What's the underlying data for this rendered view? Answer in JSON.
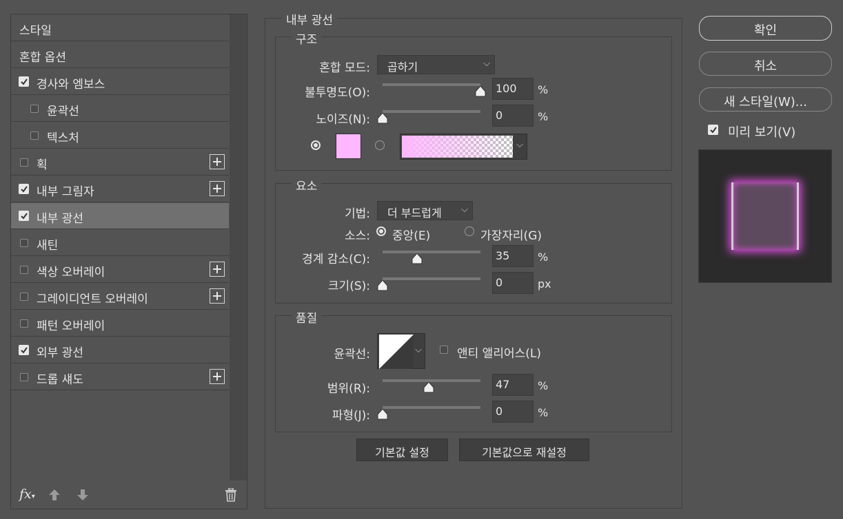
{
  "styles_list": {
    "items": [
      {
        "label": "스타일",
        "checkbox": false,
        "checked": false,
        "plus": false,
        "selected": false,
        "indent": false
      },
      {
        "label": "혼합 옵션",
        "checkbox": false,
        "checked": false,
        "plus": false,
        "selected": false,
        "indent": false
      },
      {
        "label": "경사와 엠보스",
        "checkbox": true,
        "checked": true,
        "plus": false,
        "selected": false,
        "indent": false
      },
      {
        "label": "윤곽선",
        "checkbox": true,
        "checked": false,
        "plus": false,
        "selected": false,
        "indent": true
      },
      {
        "label": "텍스처",
        "checkbox": true,
        "checked": false,
        "plus": false,
        "selected": false,
        "indent": true
      },
      {
        "label": "획",
        "checkbox": true,
        "checked": false,
        "plus": true,
        "selected": false,
        "indent": false
      },
      {
        "label": "내부 그림자",
        "checkbox": true,
        "checked": true,
        "plus": true,
        "selected": false,
        "indent": false
      },
      {
        "label": "내부 광선",
        "checkbox": true,
        "checked": true,
        "plus": false,
        "selected": true,
        "indent": false
      },
      {
        "label": "새틴",
        "checkbox": true,
        "checked": false,
        "plus": false,
        "selected": false,
        "indent": false
      },
      {
        "label": "색상 오버레이",
        "checkbox": true,
        "checked": false,
        "plus": true,
        "selected": false,
        "indent": false
      },
      {
        "label": "그레이디언트 오버레이",
        "checkbox": true,
        "checked": false,
        "plus": true,
        "selected": false,
        "indent": false
      },
      {
        "label": "패턴 오버레이",
        "checkbox": true,
        "checked": false,
        "plus": false,
        "selected": false,
        "indent": false
      },
      {
        "label": "외부 광선",
        "checkbox": true,
        "checked": true,
        "plus": false,
        "selected": false,
        "indent": false
      },
      {
        "label": "드롭 섀도",
        "checkbox": true,
        "checked": false,
        "plus": true,
        "selected": false,
        "indent": false
      }
    ],
    "footer": {
      "fx_label": "fx",
      "fx_icon": "fx-icon",
      "up_icon": "arrow-up-icon",
      "down_icon": "arrow-down-icon",
      "trash_icon": "trash-icon"
    }
  },
  "panel": {
    "title": "내부 광선",
    "structure": {
      "title": "구조",
      "blend_mode_label": "혼합 모드:",
      "blend_mode_value": "곱하기",
      "opacity_label": "불투명도(O):",
      "opacity_value": "100",
      "opacity_pct": 100,
      "noise_label": "노이즈(N):",
      "noise_value": "0",
      "noise_pct": 0,
      "unit_percent": "%",
      "glow_color": "#ffb7ff",
      "solid_selected": true
    },
    "elements": {
      "title": "요소",
      "technique_label": "기법:",
      "technique_value": "더 부드럽게",
      "source_label": "소스:",
      "source_center": "중앙(E)",
      "source_edge": "가장자리(G)",
      "source_center_selected": true,
      "choke_label": "경계 감소(C):",
      "choke_value": "35",
      "choke_pct": 35,
      "size_label": "크기(S):",
      "size_value": "0",
      "size_pct": 0,
      "unit_percent": "%",
      "unit_px": "px"
    },
    "quality": {
      "title": "품질",
      "contour_label": "윤곽선:",
      "anti_alias_label": "앤티 앨리어스(L)",
      "anti_alias_checked": false,
      "range_label": "범위(R):",
      "range_value": "47",
      "range_pct": 47,
      "jitter_label": "파형(J):",
      "jitter_value": "0",
      "jitter_pct": 0,
      "unit_percent": "%"
    },
    "make_default": "기본값 설정",
    "reset_default": "기본값으로 재설정"
  },
  "actions": {
    "ok": "확인",
    "cancel": "취소",
    "new_style": "새 스타일(W)...",
    "preview_label": "미리 보기(V)",
    "preview_checked": true,
    "preview_glow_color": "#e050e0"
  }
}
